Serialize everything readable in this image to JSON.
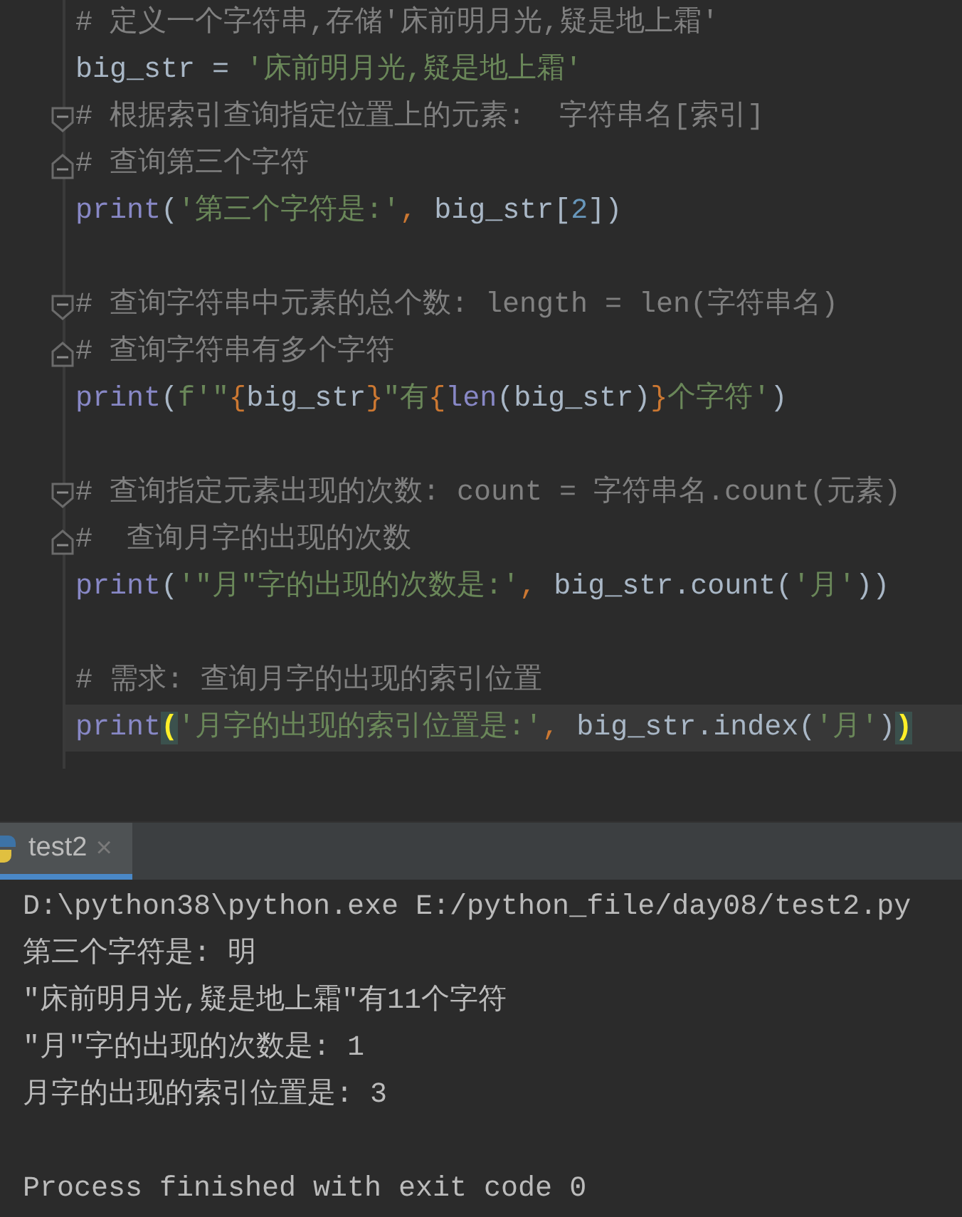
{
  "editor": {
    "lines": [
      {
        "kind": "code",
        "current": false,
        "tokens": [
          {
            "kind": "comment",
            "text": "# 定义一个字符串,存储'床前明月光,疑是地上霜'"
          }
        ]
      },
      {
        "kind": "code",
        "current": false,
        "tokens": [
          {
            "kind": "ident",
            "text": "big_str = "
          },
          {
            "kind": "string",
            "text": "'床前明月光,疑是地上霜'"
          }
        ]
      },
      {
        "kind": "fold_start",
        "current": false,
        "tokens": [
          {
            "kind": "comment",
            "text": "# 根据索引查询指定位置上的元素:  字符串名[索引]"
          }
        ]
      },
      {
        "kind": "fold_end",
        "current": false,
        "tokens": [
          {
            "kind": "comment",
            "text": "# 查询第三个字符"
          }
        ]
      },
      {
        "kind": "code",
        "current": false,
        "tokens": [
          {
            "kind": "builtin",
            "text": "print"
          },
          {
            "kind": "ident",
            "text": "("
          },
          {
            "kind": "string",
            "text": "'第三个字符是:'"
          },
          {
            "kind": "punct",
            "text": ", "
          },
          {
            "kind": "ident",
            "text": "big_str["
          },
          {
            "kind": "number",
            "text": "2"
          },
          {
            "kind": "ident",
            "text": "])"
          }
        ]
      },
      {
        "kind": "blank"
      },
      {
        "kind": "fold_start",
        "current": false,
        "tokens": [
          {
            "kind": "comment",
            "text": "# 查询字符串中元素的总个数: length = len(字符串名)"
          }
        ]
      },
      {
        "kind": "fold_end",
        "current": false,
        "tokens": [
          {
            "kind": "comment",
            "text": "# 查询字符串有多个字符"
          }
        ]
      },
      {
        "kind": "code",
        "current": false,
        "tokens": [
          {
            "kind": "builtin",
            "text": "print"
          },
          {
            "kind": "ident",
            "text": "("
          },
          {
            "kind": "string",
            "text": "f'\""
          },
          {
            "kind": "punct",
            "text": "{"
          },
          {
            "kind": "ident",
            "text": "big_str"
          },
          {
            "kind": "punct",
            "text": "}"
          },
          {
            "kind": "string",
            "text": "\"有"
          },
          {
            "kind": "punct",
            "text": "{"
          },
          {
            "kind": "builtin",
            "text": "len"
          },
          {
            "kind": "ident",
            "text": "(big_str)"
          },
          {
            "kind": "punct",
            "text": "}"
          },
          {
            "kind": "string",
            "text": "个字符'"
          },
          {
            "kind": "ident",
            "text": ")"
          }
        ]
      },
      {
        "kind": "blank"
      },
      {
        "kind": "fold_start",
        "current": false,
        "tokens": [
          {
            "kind": "comment",
            "text": "# 查询指定元素出现的次数: count = 字符串名.count(元素)"
          }
        ]
      },
      {
        "kind": "fold_end",
        "current": false,
        "tokens": [
          {
            "kind": "comment",
            "text": "#  查询月字的出现的次数"
          }
        ]
      },
      {
        "kind": "code",
        "current": false,
        "tokens": [
          {
            "kind": "builtin",
            "text": "print"
          },
          {
            "kind": "ident",
            "text": "("
          },
          {
            "kind": "string",
            "text": "'\"月\"字的出现的次数是:'"
          },
          {
            "kind": "punct",
            "text": ", "
          },
          {
            "kind": "ident",
            "text": "big_str.count("
          },
          {
            "kind": "string",
            "text": "'月'"
          },
          {
            "kind": "ident",
            "text": "))"
          }
        ]
      },
      {
        "kind": "blank"
      },
      {
        "kind": "code",
        "current": false,
        "tokens": [
          {
            "kind": "comment",
            "text": "# 需求: 查询月字的出现的索引位置"
          }
        ]
      },
      {
        "kind": "code",
        "current": true,
        "tokens": [
          {
            "kind": "builtin",
            "text": "print"
          },
          {
            "kind": "match",
            "text": "("
          },
          {
            "kind": "string",
            "text": "'月字的出现的索引位置是:'"
          },
          {
            "kind": "punct",
            "text": ", "
          },
          {
            "kind": "ident",
            "text": "big_str.index("
          },
          {
            "kind": "string",
            "text": "'月'"
          },
          {
            "kind": "ident",
            "text": ")"
          },
          {
            "kind": "match",
            "text": ")"
          }
        ]
      }
    ]
  },
  "run_panel": {
    "tabs": [
      {
        "label": "test2",
        "selected": true,
        "close": "×"
      }
    ],
    "output": [
      "D:\\python38\\python.exe E:/python_file/day08/test2.py",
      "第三个字符是: 明",
      "\"床前明月光,疑是地上霜\"有11个字符",
      "\"月\"字的出现的次数是: 1",
      "月字的出现的索引位置是: 3"
    ],
    "exit_message": "Process finished with exit code 0"
  }
}
